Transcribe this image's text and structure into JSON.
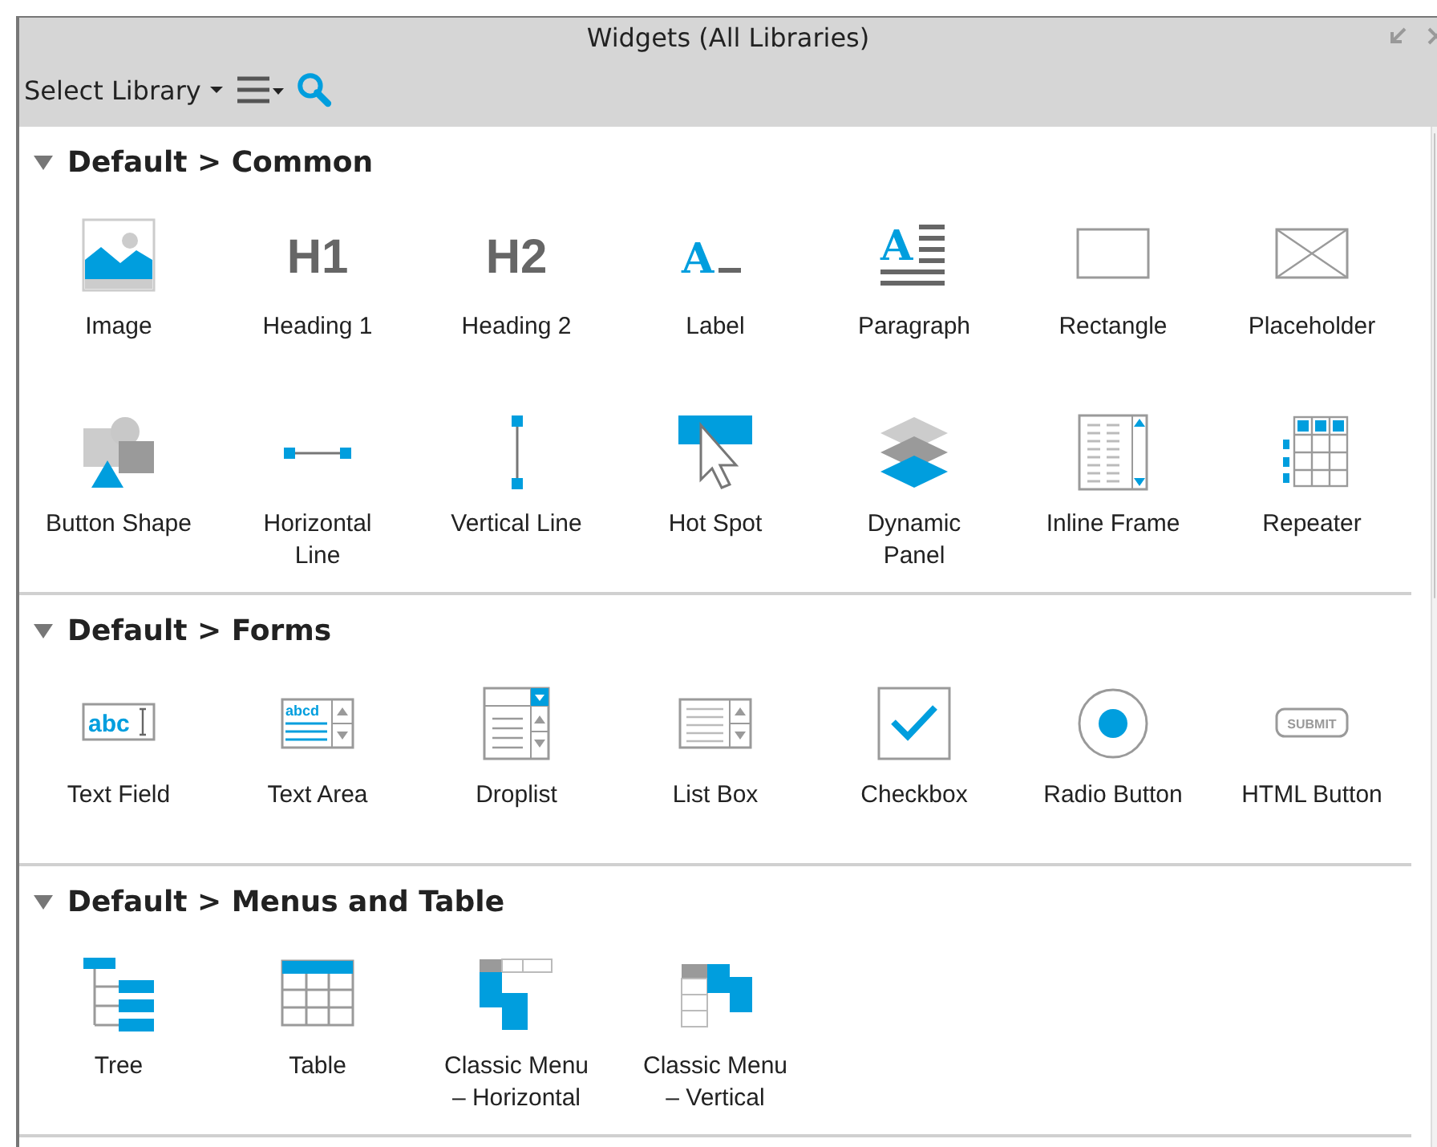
{
  "window": {
    "title": "Widgets (All Libraries)"
  },
  "toolbar": {
    "library_label": "Select Library"
  },
  "sections": [
    {
      "title": "Default > Common",
      "expanded": true,
      "widgets": [
        {
          "label": "Image",
          "kind": "image"
        },
        {
          "label": "Heading 1",
          "kind": "heading",
          "glyph": "H1"
        },
        {
          "label": "Heading 2",
          "kind": "heading",
          "glyph": "H2"
        },
        {
          "label": "Label",
          "kind": "label",
          "glyph": "A"
        },
        {
          "label": "Paragraph",
          "kind": "paragraph",
          "glyph": "A"
        },
        {
          "label": "Rectangle",
          "kind": "rectangle"
        },
        {
          "label": "Placeholder",
          "kind": "placeholder"
        },
        {
          "label": "Button Shape",
          "kind": "shapes"
        },
        {
          "label": "Horizontal Line",
          "kind": "hline"
        },
        {
          "label": "Vertical Line",
          "kind": "vline"
        },
        {
          "label": "Hot Spot",
          "kind": "hotspot"
        },
        {
          "label": "Dynamic Panel",
          "kind": "layers"
        },
        {
          "label": "Inline Frame",
          "kind": "iframe"
        },
        {
          "label": "Repeater",
          "kind": "repeater"
        }
      ]
    },
    {
      "title": "Default > Forms",
      "expanded": true,
      "widgets": [
        {
          "label": "Text Field",
          "kind": "textfield",
          "glyph": "abc"
        },
        {
          "label": "Text Area",
          "kind": "textarea",
          "glyph": "abcd"
        },
        {
          "label": "Droplist",
          "kind": "droplist"
        },
        {
          "label": "List Box",
          "kind": "listbox"
        },
        {
          "label": "Checkbox",
          "kind": "checkbox"
        },
        {
          "label": "Radio Button",
          "kind": "radio"
        },
        {
          "label": "HTML Button",
          "kind": "submit",
          "glyph": "SUBMIT"
        }
      ]
    },
    {
      "title": "Default > Menus and Table",
      "expanded": true,
      "widgets": [
        {
          "label": "Tree",
          "kind": "tree"
        },
        {
          "label": "Table",
          "kind": "table"
        },
        {
          "label": "Classic Menu – Horizontal",
          "kind": "menuh"
        },
        {
          "label": "Classic Menu – Vertical",
          "kind": "menuv"
        }
      ]
    }
  ]
}
